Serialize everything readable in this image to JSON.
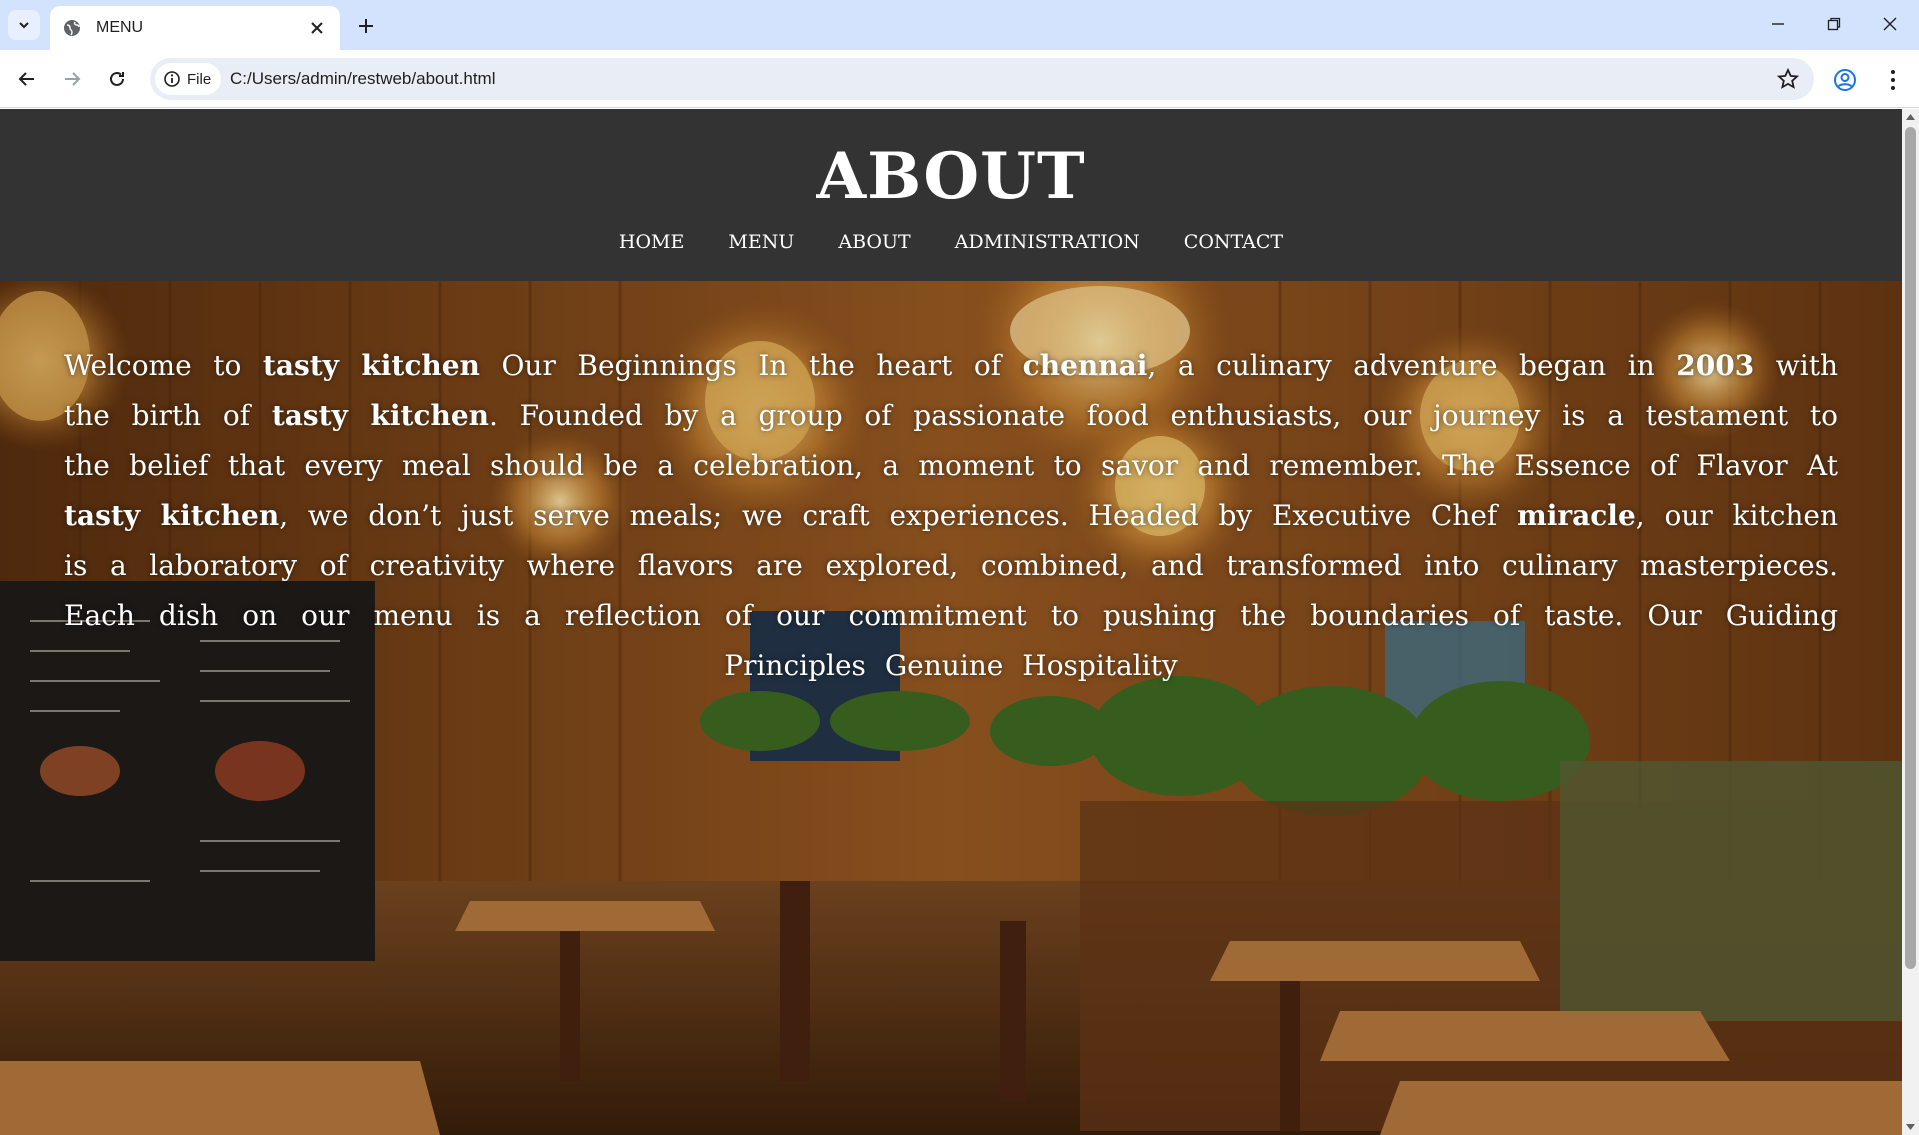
{
  "browser": {
    "tab_title": "MENU",
    "chip_label": "File",
    "url": "C:/Users/admin/restweb/about.html"
  },
  "header": {
    "title": "ABOUT",
    "nav": [
      "HOME",
      "MENU",
      "ABOUT",
      "ADMINISTRATION",
      "CONTACT"
    ]
  },
  "about": {
    "p1": "Welcome to ",
    "b1": "tasty kitchen",
    "p2": " Our Beginnings In the heart of ",
    "b2": "chennai",
    "p3": ", a culinary adventure began in ",
    "b3": "2003",
    "p4": " with the birth of ",
    "b4": "tasty kitchen",
    "p5": ". Founded by a group of passionate food enthusiasts, our journey is a testament to the belief that every meal should be a celebration, a moment to savor and remember. The Essence of Flavor At ",
    "b5": "tasty kitchen",
    "p6": ", we don’t just serve meals; we craft experiences. Headed by Executive Chef ",
    "b6": "miracle",
    "p7": ", our kitchen is a laboratory of creativity where flavors are explored, combined, and transformed into culinary masterpieces. Each dish on our menu is a reflection of our commitment to pushing the boundaries of taste. Our Guiding Principles Genuine Hospitality"
  },
  "icons": {
    "tab_list": "chevron-down-icon",
    "favicon": "globe-icon",
    "close": "close-icon",
    "new_tab": "plus-icon",
    "back": "arrow-left-icon",
    "forward": "arrow-right-icon",
    "reload": "reload-icon",
    "info": "info-icon",
    "bookmark": "star-icon",
    "profile": "profile-icon",
    "menu": "kebab-icon"
  },
  "colors": {
    "tabstrip": "#d3e3fd",
    "header_bg": "#333333",
    "text": "#ffffff"
  }
}
